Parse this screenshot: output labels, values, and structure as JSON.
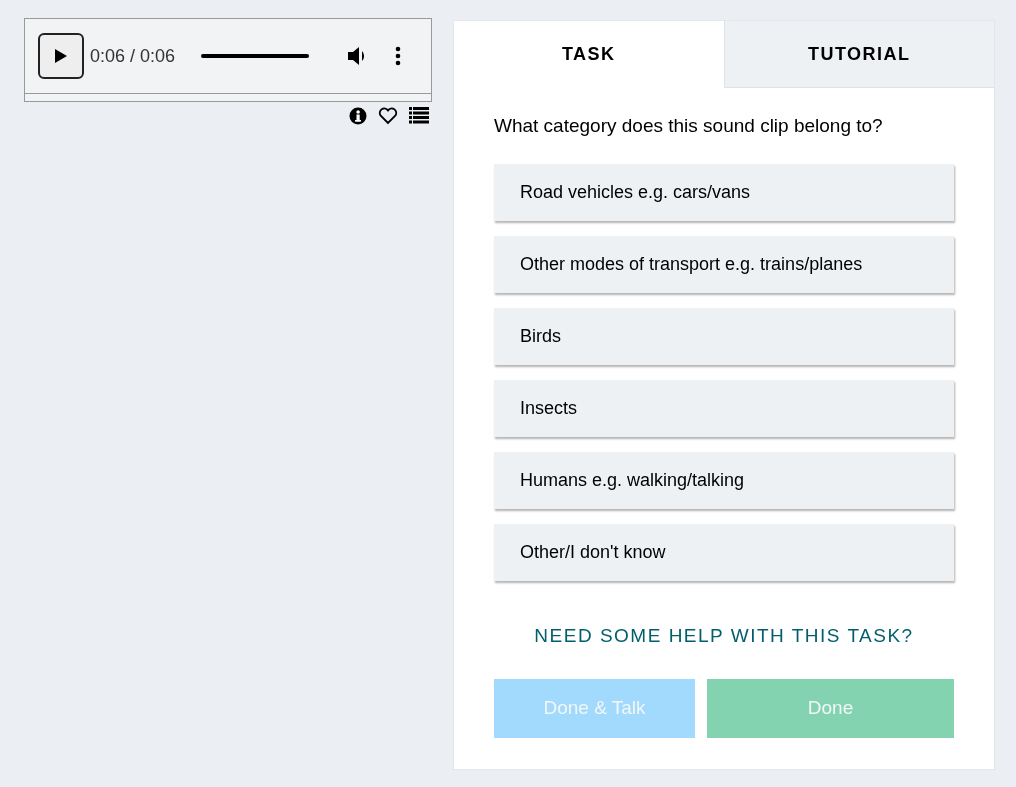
{
  "player": {
    "time": "0:06 / 0:06",
    "level": 1
  },
  "tabs": [
    {
      "label": "TASK",
      "selected": true
    },
    {
      "label": "TUTORIAL",
      "selected": false
    }
  ],
  "question": "What category does this sound clip belong to?",
  "answers": [
    {
      "label": "Road vehicles e.g. cars/vans",
      "selected": false
    },
    {
      "label": "Other modes of transport e.g. trains/planes",
      "selected": false
    },
    {
      "label": "Birds",
      "selected": false
    },
    {
      "label": "Insects",
      "selected": false
    },
    {
      "label": "Humans e.g. walking/talking",
      "selected": false
    },
    {
      "label": "Other/I don't know",
      "selected": false
    }
  ],
  "help_link": "NEED SOME HELP WITH THIS TASK?",
  "buttons": [
    {
      "label": "Done & Talk",
      "kind": "talk",
      "disabled": true
    },
    {
      "label": "Done",
      "kind": "done",
      "disabled": true
    }
  ]
}
